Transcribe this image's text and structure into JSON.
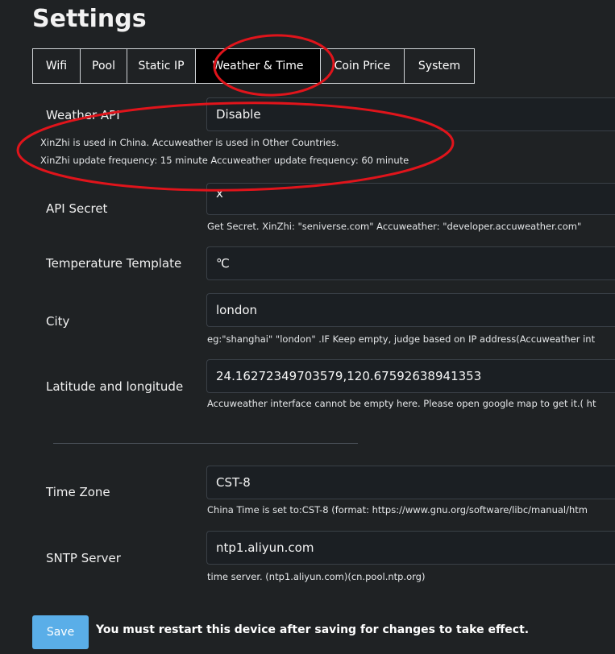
{
  "page": {
    "title": "Settings"
  },
  "tabs": [
    {
      "label": "Wifi"
    },
    {
      "label": "Pool"
    },
    {
      "label": "Static IP"
    },
    {
      "label": "Weather & Time",
      "active": true
    },
    {
      "label": "Coin Price"
    },
    {
      "label": "System"
    }
  ],
  "weather_api": {
    "label": "Weather API",
    "value": "Disable",
    "help_line1": "XinZhi is used in China. Accuweather is used in Other Countries.",
    "help_line2": "XinZhi update frequency: 15 minute Accuweather update frequency: 60 minute"
  },
  "api_secret": {
    "label": "API Secret",
    "value": "x",
    "help": "Get Secret. XinZhi: \"seniverse.com\" Accuweather: \"developer.accuweather.com\""
  },
  "temperature_template": {
    "label": "Temperature Template",
    "value": "℃"
  },
  "city": {
    "label": "City",
    "value": "london",
    "help": "eg:\"shanghai\" \"london\" .IF Keep empty, judge based on IP address(Accuweather int"
  },
  "lat_long": {
    "label": "Latitude and longitude",
    "value": "24.16272349703579,120.67592638941353",
    "help": "Accuweather interface cannot be empty here. Please open google map to get it.( ht"
  },
  "time_zone": {
    "label": "Time Zone",
    "value": "CST-8",
    "help": "China Time is set to:CST-8 (format: https://www.gnu.org/software/libc/manual/htm"
  },
  "sntp_server": {
    "label": "SNTP Server",
    "value": "ntp1.aliyun.com",
    "help": "time server. (ntp1.aliyun.com)(cn.pool.ntp.org)"
  },
  "footer": {
    "save_label": "Save",
    "restart_note": "You must restart this device after saving for changes to take effect."
  },
  "colors": {
    "background": "#1f2224",
    "active_tab": "#000000",
    "save_button": "#5aaee8",
    "annotation_ellipse": "#e0141b"
  }
}
